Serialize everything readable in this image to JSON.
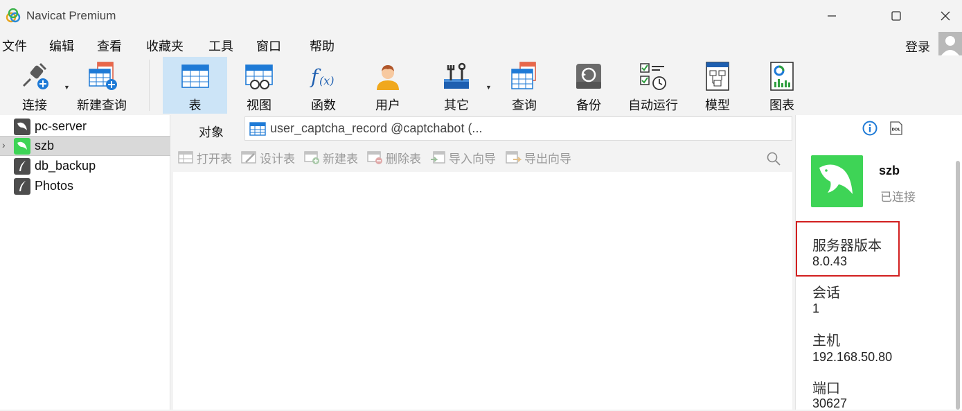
{
  "window": {
    "title": "Navicat Premium"
  },
  "menubar": {
    "items": [
      "文件",
      "编辑",
      "查看",
      "收藏夹",
      "工具",
      "窗口",
      "帮助"
    ],
    "login": "登录"
  },
  "toolbar": {
    "items": [
      {
        "label": "连接",
        "icon": "connection-plug-icon"
      },
      {
        "label": "新建查询",
        "icon": "new-query-icon"
      },
      {
        "label": "表",
        "icon": "table-icon",
        "active": true
      },
      {
        "label": "视图",
        "icon": "view-icon"
      },
      {
        "label": "函数",
        "icon": "function-icon"
      },
      {
        "label": "用户",
        "icon": "user-icon"
      },
      {
        "label": "其它",
        "icon": "tools-icon"
      },
      {
        "label": "查询",
        "icon": "query-icon"
      },
      {
        "label": "备份",
        "icon": "backup-icon"
      },
      {
        "label": "自动运行",
        "icon": "auto-run-icon"
      },
      {
        "label": "模型",
        "icon": "model-icon"
      },
      {
        "label": "图表",
        "icon": "chart-icon"
      }
    ]
  },
  "connections": [
    {
      "name": "pc-server",
      "status": "disconnected"
    },
    {
      "name": "szb",
      "status": "connected",
      "selected": true
    },
    {
      "name": "db_backup",
      "status": "disconnected"
    },
    {
      "name": "Photos",
      "status": "disconnected"
    }
  ],
  "tabs": {
    "objects": "对象",
    "document": "user_captcha_record @captchabot (..."
  },
  "object_toolbar": {
    "open": "打开表",
    "design": "设计表",
    "new": "新建表",
    "delete": "删除表",
    "import": "导入向导",
    "export": "导出向导"
  },
  "info_panel": {
    "name": "szb",
    "status": "已连接",
    "properties": [
      {
        "label": "服务器版本",
        "value": "8.0.43"
      },
      {
        "label": "会话",
        "value": "1"
      },
      {
        "label": "主机",
        "value": "192.168.50.80"
      },
      {
        "label": "端口",
        "value": "30627"
      }
    ]
  },
  "colors": {
    "accent": "#1e7ad6",
    "mysql_green": "#3ed456",
    "active_tool": "#cce4f7",
    "highlight_box": "#d21f1f"
  }
}
